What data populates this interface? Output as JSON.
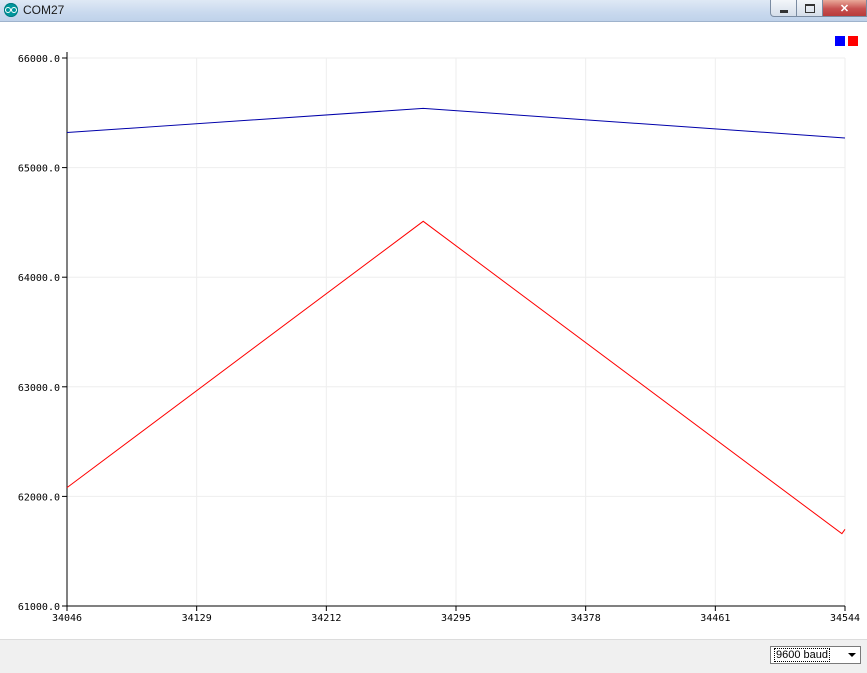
{
  "window": {
    "title": "COM27"
  },
  "statusbar": {
    "baud_rate": "9600 baud"
  },
  "chart_data": {
    "type": "line",
    "title": "",
    "xlabel": "",
    "ylabel": "",
    "xlim": [
      34046,
      34544
    ],
    "ylim": [
      61000,
      66000
    ],
    "grid": true,
    "legend": "top-right",
    "x_ticks": [
      "34046",
      "34129",
      "34212",
      "34295",
      "34378",
      "34461",
      "34544"
    ],
    "y_ticks": [
      "61000.0",
      "62000.0",
      "63000.0",
      "64000.0",
      "65000.0",
      "66000.0"
    ],
    "series": [
      {
        "color": "#0000aa",
        "legend_color": "#0000ff",
        "points": [
          [
            34046,
            65320
          ],
          [
            34274,
            65540
          ],
          [
            34544,
            65270
          ]
        ]
      },
      {
        "color": "#ff0000",
        "legend_color": "#ff0000",
        "points": [
          [
            34046,
            62080
          ],
          [
            34274,
            64510
          ],
          [
            34542,
            61660
          ],
          [
            34544,
            61700
          ]
        ]
      }
    ]
  }
}
